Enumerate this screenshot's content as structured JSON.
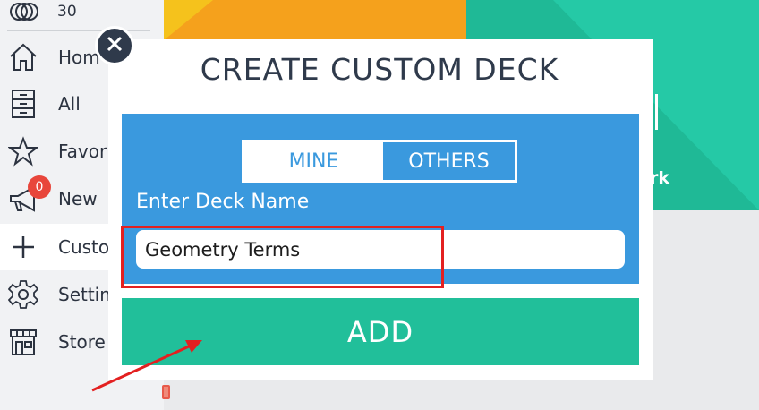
{
  "sidebar": {
    "count": "30",
    "items": [
      {
        "label": "Hom",
        "icon": "home-icon"
      },
      {
        "label": "All",
        "icon": "cabinet-icon"
      },
      {
        "label": "Favor",
        "icon": "star-icon"
      },
      {
        "label": "New",
        "icon": "megaphone-icon",
        "badge": "0"
      },
      {
        "label": "Custo",
        "icon": "plus-icon"
      },
      {
        "label": "Settin",
        "icon": "gear-icon"
      },
      {
        "label": "Store",
        "icon": "store-icon"
      }
    ]
  },
  "background": {
    "teal_tile_text": "rk"
  },
  "modal": {
    "title": "CREATE CUSTOM DECK",
    "segment": {
      "mine": "MINE",
      "others": "OTHERS",
      "selected": "MINE"
    },
    "deck_label": "Enter Deck Name",
    "deck_input_value": "Geometry Terms",
    "add_label": "ADD"
  },
  "colors": {
    "accent_blue": "#3a99de",
    "accent_green": "#21bf9a",
    "dark": "#2f3a4b",
    "annotation_red": "#e32020"
  }
}
